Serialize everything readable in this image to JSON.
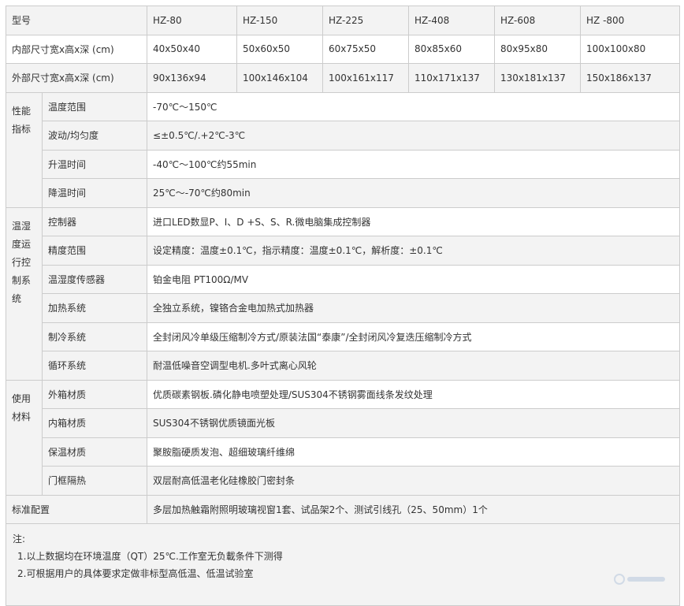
{
  "header": {
    "label": "型号",
    "models": [
      "HZ-80",
      "HZ-150",
      "HZ-225",
      "HZ-408",
      "HZ-608",
      "HZ -800"
    ]
  },
  "inner_size": {
    "label": "内部尺寸宽x高x深 (cm)",
    "values": [
      "40x50x40",
      "50x60x50",
      "60x75x50",
      "80x85x60",
      "80x95x80",
      "100x100x80"
    ]
  },
  "outer_size": {
    "label": "外部尺寸宽x高x深 (cm)",
    "values": [
      "90x136x94",
      "100x146x104",
      "100x161x117",
      "110x171x137",
      "130x181x137",
      "150x186x137"
    ]
  },
  "performance": {
    "group": "性能指标",
    "rows": [
      {
        "name": "温度范围",
        "value": "-70℃～150℃"
      },
      {
        "name": "波动/均匀度",
        "value": "≤±0.5℃/.+2℃-3℃"
      },
      {
        "name": "升温时间",
        "value": "-40℃～100℃约55min"
      },
      {
        "name": "降温时间",
        "value": "25℃～-70℃约80min"
      }
    ]
  },
  "control": {
    "group": "温湿度运行控制系统",
    "rows": [
      {
        "name": "控制器",
        "value": "进口LED数显P、I、D +S、S、R.微电脑集成控制器"
      },
      {
        "name": "精度范围",
        "value": "设定精度：温度±0.1℃，指示精度：温度±0.1℃，解析度：±0.1℃"
      },
      {
        "name": "温湿度传感器",
        "value": "铂金电阻 PT100Ω/MV"
      },
      {
        "name": "加热系统",
        "value": "全独立系统，镍铬合金电加热式加热器"
      },
      {
        "name": "制冷系统",
        "value": "全封闭风冷单级压缩制冷方式/原装法国“泰康”/全封闭风冷复迭压缩制冷方式"
      },
      {
        "name": "循环系统",
        "value": "耐温低噪音空调型电机.多叶式离心风轮"
      }
    ]
  },
  "materials": {
    "group": "使用材料",
    "rows": [
      {
        "name": "外箱材质",
        "value": "优质碳素钢板.磷化静电喷塑处理/SUS304不锈钢雾面线条发纹处理"
      },
      {
        "name": "内箱材质",
        "value": "SUS304不锈钢优质镜面光板"
      },
      {
        "name": "保温材质",
        "value": "聚胺脂硬质发泡、超细玻璃纤维绵"
      },
      {
        "name": "门框隔热",
        "value": "双层耐高低温老化硅橡胶门密封条"
      }
    ]
  },
  "standard": {
    "label": "标准配置",
    "value": "多层加热触霜附照明玻璃视窗1套、试品架2个、测试引线孔（25、50mm）1个"
  },
  "notes": {
    "title": "注:",
    "lines": [
      "1.以上数据均在环境温度（QT）25℃.工作室无负載条件下测得",
      "2.可根据用户的具体要求定做非标型高低温、低温试验室"
    ]
  }
}
